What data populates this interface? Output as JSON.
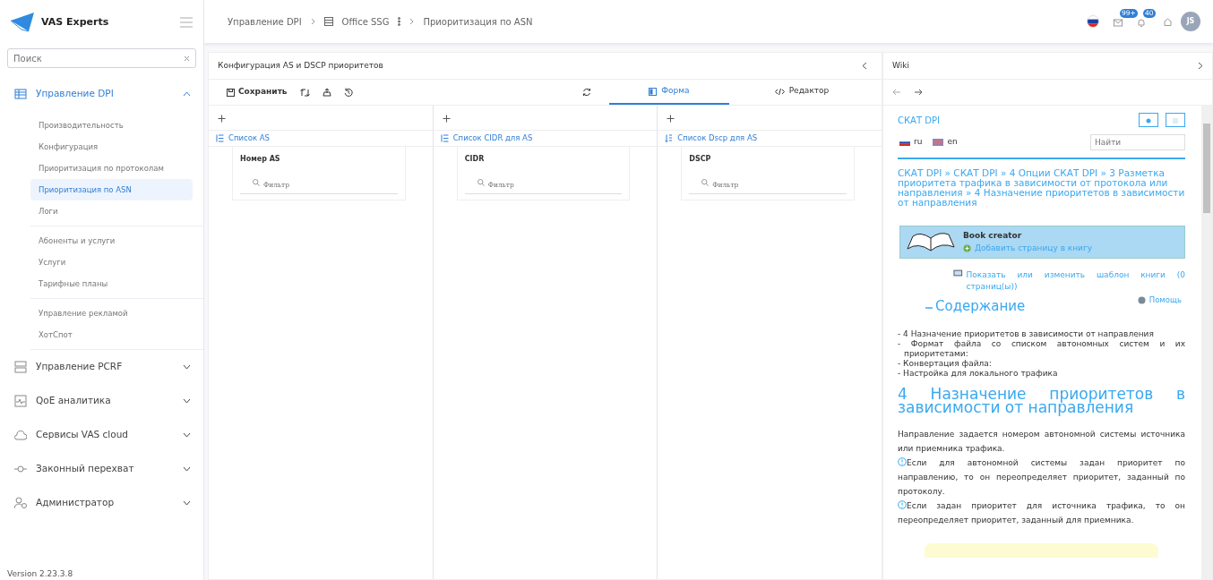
{
  "sidebar": {
    "logo_text": "VAS Experts",
    "search": {
      "placeholder": "Поиск"
    },
    "sections": [
      {
        "label": "Управление DPI",
        "expanded": true,
        "groups": [
          [
            {
              "label": "Производительность",
              "selected": false
            },
            {
              "label": "Конфигурация",
              "selected": false
            },
            {
              "label": "Приоритизация по протоколам",
              "selected": false
            },
            {
              "label": "Приоритизация по ASN",
              "selected": true
            },
            {
              "label": "Логи",
              "selected": false
            }
          ],
          [
            {
              "label": "Абоненты и услуги",
              "selected": false
            },
            {
              "label": "Услуги",
              "selected": false
            },
            {
              "label": "Тарифные планы",
              "selected": false
            }
          ],
          [
            {
              "label": "Управление рекламой",
              "selected": false
            },
            {
              "label": "ХотСпот",
              "selected": false
            }
          ]
        ]
      },
      {
        "label": "Управление PCRF",
        "expanded": false
      },
      {
        "label": "QoE аналитика",
        "expanded": false
      },
      {
        "label": "Сервисы VAS cloud",
        "expanded": false
      },
      {
        "label": "Законный перехват",
        "expanded": false
      },
      {
        "label": "Администратор",
        "expanded": false
      }
    ],
    "version": "Version 2.23.3.8"
  },
  "header": {
    "breadcrumbs": [
      {
        "label": "Управление DPI",
        "kind": "text"
      },
      {
        "label": "Office SSG",
        "kind": "device"
      },
      {
        "label": "Приоритизация по ASN",
        "kind": "text"
      }
    ],
    "mail_badge": "99+",
    "bell_badge": "40",
    "avatar": "JS"
  },
  "config": {
    "title": "Конфигурация AS и DSCP приоритетов",
    "save": "Сохранить",
    "tabs": [
      {
        "label": "Форма",
        "selected": true
      },
      {
        "label": "Редактор",
        "selected": false
      }
    ],
    "lists": [
      {
        "title": "Список AS",
        "column": "Номер AS",
        "filter_placeholder": "Фильтр"
      },
      {
        "title": "Список CIDR для AS",
        "column": "CIDR",
        "filter_placeholder": "Фильтр"
      },
      {
        "title": "Список Dscp для AS",
        "column": "DSCP",
        "filter_placeholder": "Фильтр"
      }
    ]
  },
  "wiki": {
    "title": "Wiki",
    "site_title": "СКАТ DPI",
    "languages": [
      "ru",
      "en"
    ],
    "search": {
      "placeholder": "Найти"
    },
    "path": "СКАТ DPI » СКАТ DPI » 4 Опции СКАТ DPI » 3 Разметка приоритета трафика в зависимости от протокола или направления » 4 Назначение приоритетов в зависимости от направления",
    "book": {
      "title": "Book creator",
      "add": "Добавить страницу в книгу",
      "show": "Показать или изменить шаблон книги (0 страниц(ы))"
    },
    "help": "Помощь",
    "toc_title": "Содержание",
    "toc": [
      "- 4 Назначение приоритетов в зависимости от направления",
      "- Формат файла со списком автономных систем и их приоритетами:",
      "- Конвертация файла:",
      "- Настройка для локального трафика"
    ],
    "heading": "4 Назначение приоритетов в зависимости от направления",
    "paragraphs": [
      {
        "kind": "text",
        "text": "Направление задается номером автономной системы источника или приемника трафика."
      },
      {
        "kind": "note",
        "text": "Если для автономной системы задан приоритет по направлению, то он переопределяет приоритет, заданный по протоколу."
      },
      {
        "kind": "note",
        "text": "Если задан приоритет для источника трафика, то он переопределяет приоритет, заданный для приемника."
      }
    ]
  }
}
